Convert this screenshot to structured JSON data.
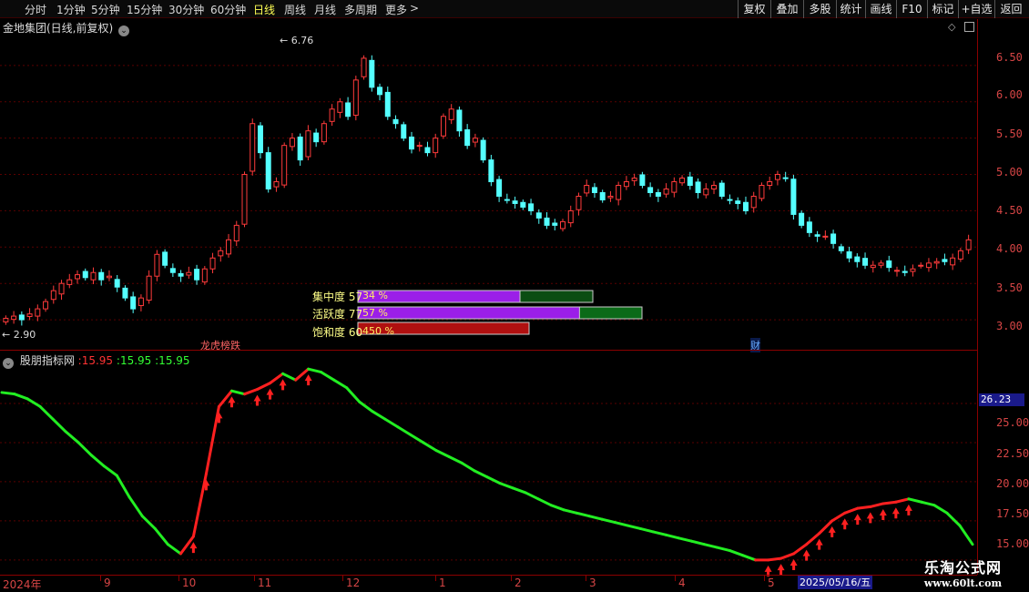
{
  "toolbar": {
    "periods": [
      "分时",
      "1分钟",
      "5分钟",
      "15分钟",
      "30分钟",
      "60分钟",
      "日线",
      "周线",
      "月线",
      "多周期",
      "更多"
    ],
    "more_arrow": ">",
    "active_period": "日线",
    "buttons": [
      "复权",
      "叠加",
      "多股",
      "统计",
      "画线",
      "F10",
      "标记",
      "+自选",
      "返回"
    ]
  },
  "main_panel": {
    "title": "金地集团(日线,前复权)",
    "chevron": "⌄",
    "high_label": "6.76",
    "low_label": "2.90",
    "y_ticks": [
      "6.50",
      "6.00",
      "5.50",
      "5.00",
      "4.50",
      "4.00",
      "3.50",
      "3.00"
    ],
    "event_markers": [
      {
        "text": "龙虎榜跌",
        "color": "#ff6666"
      },
      {
        "text": "财",
        "color": "#66aaff"
      }
    ]
  },
  "chip_gauges": [
    {
      "label": "集中度",
      "label_value": "57",
      "bar_text": "34 %",
      "fill": 0.57
    },
    {
      "label": "活跃度",
      "label_value": "77",
      "bar_text": "57 %",
      "fill": 0.77
    },
    {
      "label": "饱和度",
      "label_value": "60",
      "bar_text": "450 %",
      "fill": 1.0
    }
  ],
  "indicator_panel": {
    "title": "股朋指标网",
    "values": [
      ":15.95",
      ":15.95",
      ":15.95"
    ],
    "value_colors": [
      "#ff3333",
      "#33ff33",
      "#33ff33"
    ],
    "current_value": "26.23",
    "y_ticks": [
      "25.00",
      "22.50",
      "20.00",
      "17.50",
      "15.00"
    ]
  },
  "date_axis": {
    "labels": [
      "2024年",
      "9",
      "10",
      "11",
      "12",
      "1",
      "2",
      "3",
      "4",
      "5"
    ],
    "current_date": "2025/05/16/五"
  },
  "watermark": {
    "title": "乐淘公式网",
    "url": "www.60lt.com"
  },
  "colors": {
    "up": "#ff3b3b",
    "down": "#54ffff",
    "indicator_up": "#ff2020",
    "indicator_down": "#22ee22",
    "grid": "#5a0000"
  },
  "chart_data": {
    "type": "candlestick",
    "price_range": [
      2.7,
      6.9
    ],
    "indicator_range": [
      14.7,
      27.5
    ],
    "close_series": [
      3.02,
      3.05,
      3.0,
      3.08,
      3.15,
      3.25,
      3.4,
      3.5,
      3.55,
      3.62,
      3.58,
      3.65,
      3.55,
      3.6,
      3.45,
      3.3,
      3.15,
      3.3,
      3.6,
      3.9,
      3.75,
      3.65,
      3.6,
      3.65,
      3.55,
      3.7,
      3.85,
      3.95,
      4.1,
      4.3,
      5.0,
      5.7,
      5.3,
      4.8,
      4.9,
      5.4,
      5.5,
      5.2,
      5.6,
      5.45,
      5.7,
      5.9,
      6.0,
      5.8,
      6.3,
      6.6,
      6.2,
      6.1,
      5.8,
      5.7,
      5.5,
      5.35,
      5.4,
      5.3,
      5.5,
      5.8,
      5.9,
      5.6,
      5.4,
      5.5,
      5.2,
      4.9,
      4.7,
      4.65,
      4.6,
      4.55,
      4.5,
      4.4,
      4.3,
      4.3,
      4.35,
      4.5,
      4.7,
      4.85,
      4.75,
      4.65,
      4.7,
      4.85,
      4.9,
      4.95,
      4.85,
      4.75,
      4.7,
      4.8,
      4.9,
      4.95,
      4.85,
      4.75,
      4.8,
      4.85,
      4.7,
      4.65,
      4.6,
      4.5,
      4.7,
      4.85,
      4.9,
      5.0,
      4.95,
      4.45,
      4.3,
      4.2,
      4.15,
      4.15,
      4.05,
      3.95,
      3.85,
      3.8,
      3.75,
      3.75,
      3.78,
      3.72,
      3.68,
      3.65,
      3.7,
      3.75,
      3.78,
      3.8,
      3.8,
      3.85,
      3.95,
      4.1
    ],
    "indicator_series": [
      25.7,
      25.6,
      25.3,
      24.8,
      24.0,
      23.2,
      22.5,
      21.7,
      21.0,
      20.4,
      19.0,
      17.8,
      17.0,
      16.0,
      15.4,
      16.5,
      20.5,
      24.8,
      25.8,
      25.6,
      25.9,
      26.3,
      26.9,
      26.5,
      27.2,
      27.0,
      26.5,
      26.0,
      25.1,
      24.5,
      24.0,
      23.5,
      23.0,
      22.5,
      22.0,
      21.6,
      21.2,
      20.7,
      20.3,
      19.9,
      19.6,
      19.3,
      18.9,
      18.5,
      18.2,
      18.0,
      17.8,
      17.6,
      17.4,
      17.2,
      17.0,
      16.8,
      16.6,
      16.4,
      16.2,
      16.0,
      15.8,
      15.6,
      15.3,
      15.0,
      15.0,
      15.1,
      15.4,
      16.0,
      16.7,
      17.5,
      18.0,
      18.3,
      18.4,
      18.6,
      18.7,
      18.9,
      18.7,
      18.5,
      18.0,
      17.2,
      16.0
    ]
  }
}
